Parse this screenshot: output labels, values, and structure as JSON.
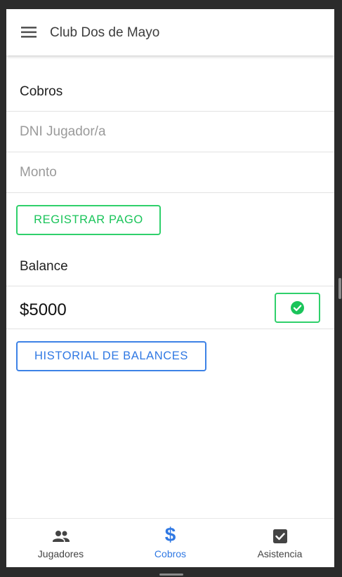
{
  "app": {
    "title": "Club Dos de Mayo",
    "menu_icon": "hamburger-menu-icon"
  },
  "cobros": {
    "section_title": "Cobros",
    "dni_placeholder": "DNI Jugador/a",
    "monto_placeholder": "Monto",
    "register_button": "REGISTRAR PAGO"
  },
  "balance": {
    "section_title": "Balance",
    "value": "$5000",
    "confirm_icon": "check-circle-icon",
    "history_button": "HISTORIAL DE BALANCES"
  },
  "bottom_nav": {
    "items": [
      {
        "label": "Jugadores",
        "icon": "people-icon",
        "active": false
      },
      {
        "label": "Cobros",
        "icon": "dollar-icon",
        "active": true
      },
      {
        "label": "Asistencia",
        "icon": "checkbox-icon",
        "active": false
      }
    ]
  },
  "colors": {
    "green_accent": "#1ac45a",
    "blue_accent": "#2f78e3"
  }
}
